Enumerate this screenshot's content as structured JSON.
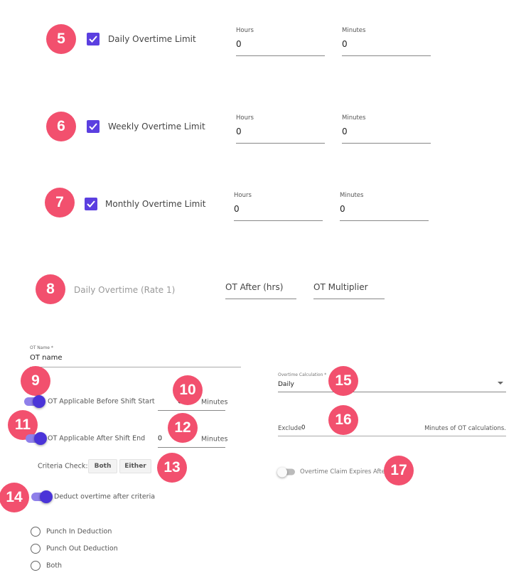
{
  "badge_color": "#f2506e",
  "accent": "#5b3fe0",
  "limits": [
    {
      "badge": "5",
      "label": "Daily Overtime Limit",
      "checked": true,
      "hours_label": "Hours",
      "hours": "0",
      "minutes_label": "Minutes",
      "minutes": "0"
    },
    {
      "badge": "6",
      "label": "Weekly Overtime Limit",
      "checked": true,
      "hours_label": "Hours",
      "hours": "0",
      "minutes_label": "Minutes",
      "minutes": "0"
    },
    {
      "badge": "7",
      "label": "Monthly Overtime Limit",
      "checked": true,
      "hours_label": "Hours",
      "hours": "0",
      "minutes_label": "Minutes",
      "minutes": "0"
    }
  ],
  "rate": {
    "badge": "8",
    "label": "Daily Overtime (Rate 1)",
    "ot_after_placeholder": "OT After (hrs)",
    "ot_multiplier_placeholder": "OT Multiplier"
  },
  "ot_name": {
    "label": "OT Name *",
    "value": "OT name"
  },
  "before_start": {
    "badge": "9",
    "label": "OT Applicable Before Shift Start",
    "on": true,
    "value": "0",
    "unit": "Minutes",
    "value_badge": "10"
  },
  "after_end": {
    "badge": "11",
    "label": "OT Applicable After Shift End",
    "on": true,
    "value": "0",
    "unit": "Minutes",
    "value_badge": "12"
  },
  "criteria": {
    "label": "Criteria Check:",
    "both": "Both",
    "either": "Either",
    "badge": "13"
  },
  "deduct": {
    "badge": "14",
    "label": "Deduct overtime after criteria",
    "on": true
  },
  "radios": [
    "Punch In Deduction",
    "Punch Out Deduction",
    "Both"
  ],
  "calculation": {
    "label": "Overtime Calculation *",
    "value": "Daily",
    "badge": "15"
  },
  "exclude": {
    "prefix": "Exclude",
    "value": "0",
    "suffix": "Minutes of OT calculations.",
    "badge": "16"
  },
  "claim_expires": {
    "label": "Overtime Claim Expires After",
    "on": false,
    "badge": "17"
  }
}
